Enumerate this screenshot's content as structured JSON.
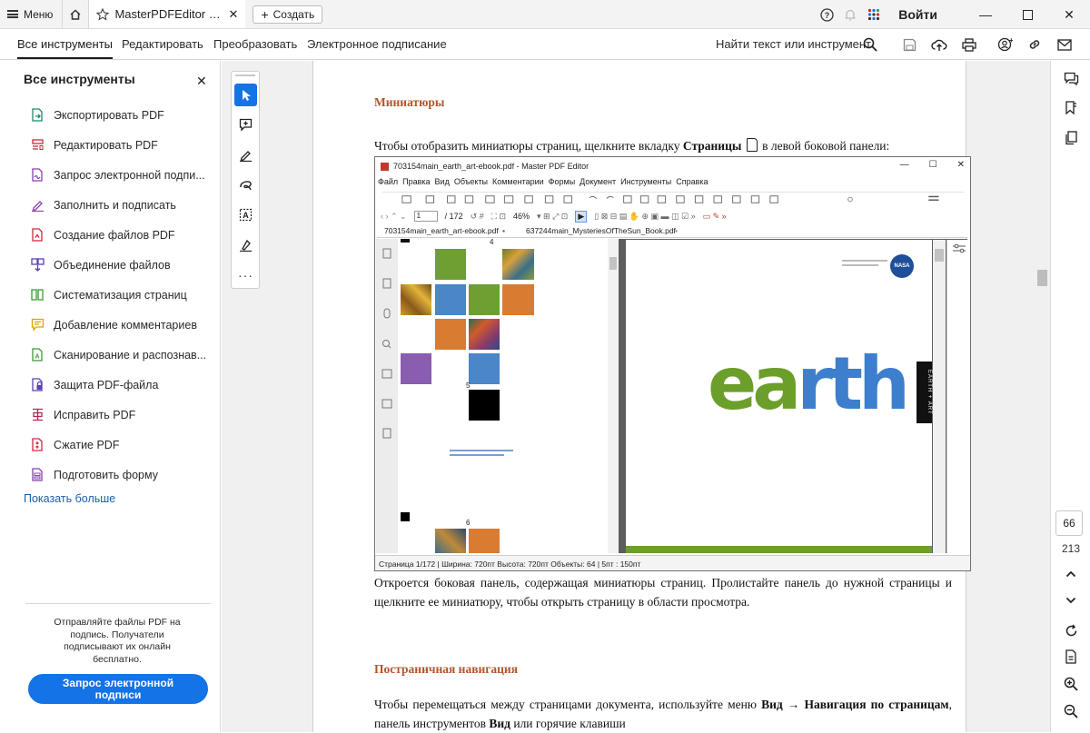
{
  "titlebar": {
    "menu_label": "Меню",
    "tab_title": "MasterPDFEditor Ру...",
    "create_label": "Создать",
    "login_label": "Войти"
  },
  "menubar": {
    "items": [
      "Все инструменты",
      "Редактировать",
      "Преобразовать",
      "Электронное подписание"
    ],
    "find_label": "Найти текст или инструмент"
  },
  "left_panel": {
    "title": "Все инструменты",
    "items": [
      {
        "label": "Экспортировать PDF",
        "icon": "export-pdf-icon",
        "color": "#1a8a6e"
      },
      {
        "label": "Редактировать PDF",
        "icon": "edit-pdf-icon",
        "color": "#d0263e"
      },
      {
        "label": "Запрос электронной подпи...",
        "icon": "request-sign-icon",
        "color": "#8b3fb5"
      },
      {
        "label": "Заполнить и подписать",
        "icon": "fill-sign-icon",
        "color": "#8b3fb5"
      },
      {
        "label": "Создание файлов PDF",
        "icon": "create-pdf-icon",
        "color": "#d0263e"
      },
      {
        "label": "Объединение файлов",
        "icon": "combine-files-icon",
        "color": "#5b3fb5"
      },
      {
        "label": "Систематизация страниц",
        "icon": "organize-pages-icon",
        "color": "#3b9b2f"
      },
      {
        "label": "Добавление комментариев",
        "icon": "comment-icon",
        "color": "#d9a400"
      },
      {
        "label": "Сканирование и распознав...",
        "icon": "scan-ocr-icon",
        "color": "#3b9b2f"
      },
      {
        "label": "Защита PDF-файла",
        "icon": "protect-pdf-icon",
        "color": "#5b3fb5"
      },
      {
        "label": "Исправить PDF",
        "icon": "redact-pdf-icon",
        "color": "#b5264f"
      },
      {
        "label": "Сжатие PDF",
        "icon": "compress-pdf-icon",
        "color": "#d0263e"
      },
      {
        "label": "Подготовить форму",
        "icon": "prepare-form-icon",
        "color": "#8b3fb5"
      }
    ],
    "show_more": "Показать больше",
    "promo_text": "Отправляйте файлы PDF на подпись. Получатели подписывают их онлайн бесплатно.",
    "promo_button": "Запрос электронной подписи"
  },
  "document": {
    "heading1": "Миниатюры",
    "para1_a": "Чтобы отобразить миниатюры страниц, щелкните вкладку ",
    "para1_b": "Страницы",
    "para1_c": " в левой боковой панели:",
    "para2": "Откроется боковая панель, содержащая миниатюры страниц. Пролистайте панель до нужной страницы и щелкните ее миниатюру, чтобы открыть страницу в области просмотра.",
    "heading2": "Постраничная навигация",
    "para3_a": "Чтобы перемещаться между страницами документа, используйте меню ",
    "para3_b": "Вид → Навигация по страницам",
    "para3_c": ", панель инструментов ",
    "para3_d": "Вид",
    "para3_e": " или горячие клавиши"
  },
  "screenshot": {
    "window_title": "703154main_earth_art-ebook.pdf - Master PDF Editor",
    "menu": [
      "Файл",
      "Правка",
      "Вид",
      "Объекты",
      "Комментарии",
      "Формы",
      "Документ",
      "Инструменты",
      "Справка"
    ],
    "page_field": "1",
    "page_total": "/ 172",
    "zoom": "46%",
    "tab1": "703154main_earth_art-ebook.pdf",
    "tab2": "637244main_MysteriesOfTheSun_Book.pdf",
    "thumb_label_4": "4",
    "thumb_label_5": "5",
    "thumb_label_6": "6",
    "earth_word": "earth",
    "side_text": "EARTH + ART",
    "nasa": "NASA",
    "status": "Страница 1/172 | Ширина: 720пт Высота: 720пт Объекты: 64 |   5пт : 150пт"
  },
  "right_rail": {
    "page_number": "66",
    "page_total": "213"
  }
}
